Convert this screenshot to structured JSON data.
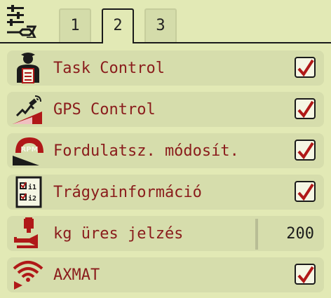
{
  "tabs": [
    {
      "label": "1",
      "active": false
    },
    {
      "label": "2",
      "active": true
    },
    {
      "label": "3",
      "active": false
    }
  ],
  "rows": [
    {
      "icon": "operator-document-icon",
      "label": "Task Control",
      "control": "checkbox",
      "checked": true
    },
    {
      "icon": "gps-satellite-icon",
      "label": "GPS Control",
      "control": "checkbox",
      "checked": true
    },
    {
      "icon": "rpm-gauge-icon",
      "label": "Fordulatsz. módosít.",
      "control": "checkbox",
      "checked": true
    },
    {
      "icon": "fertilizer-info-icon",
      "label": "Trágyainformáció",
      "control": "checkbox",
      "checked": true
    },
    {
      "icon": "weight-horn-icon",
      "label": "kg üres jelzés",
      "control": "value",
      "value": "200"
    },
    {
      "icon": "wireless-axmat-icon",
      "label": "AXMAT",
      "control": "checkbox",
      "checked": true
    }
  ],
  "colors": {
    "background": "#e2e9b5",
    "row": "#d6ddac",
    "label": "#8a1c1c",
    "check": "#b01818"
  }
}
